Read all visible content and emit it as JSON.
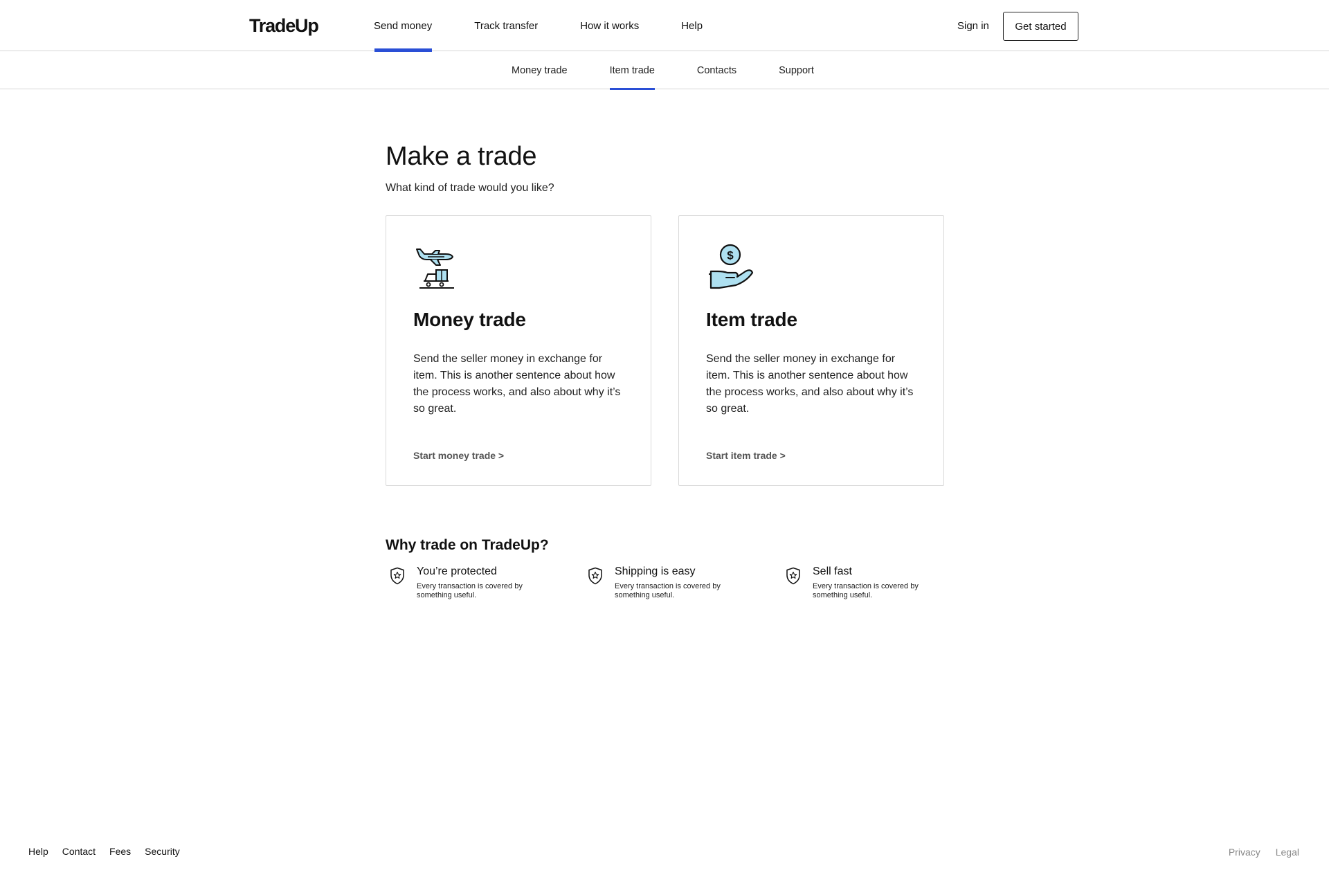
{
  "brand": {
    "name": "TradeUp",
    "accent_color": "#2a4fd6",
    "icon_fill": "#aee0f0"
  },
  "topnav": {
    "links": [
      {
        "label": "Send money",
        "active": true
      },
      {
        "label": "Track transfer",
        "active": false
      },
      {
        "label": "How it works",
        "active": false
      },
      {
        "label": "Help",
        "active": false
      }
    ],
    "sign_in": "Sign in",
    "get_started": "Get started"
  },
  "subnav": {
    "links": [
      {
        "label": "Money trade",
        "active": false
      },
      {
        "label": "Item trade",
        "active": true
      },
      {
        "label": "Contacts",
        "active": false
      },
      {
        "label": "Support",
        "active": false
      }
    ]
  },
  "main": {
    "title": "Make a trade",
    "subtitle": "What kind of trade would you like?",
    "cards": [
      {
        "icon": "airplane-delivery-icon",
        "title": "Money trade",
        "description": "Send the seller money in exchange for item. This is another sentence about how the process works, and also about why it’s so great.",
        "link": "Start money trade >"
      },
      {
        "icon": "hand-coin-icon",
        "title": "Item trade",
        "description": "Send the seller money in exchange for item. This is another sentence about how the process works, and also about why it’s so great.",
        "link": "Start item trade >"
      }
    ],
    "why": {
      "title": "Why trade on TradeUp?",
      "features": [
        {
          "icon": "shield-star-icon",
          "title": "You’re protected",
          "description": "Every transaction is covered by something useful."
        },
        {
          "icon": "shield-star-icon",
          "title": "Shipping is easy",
          "description": "Every transaction is covered by something useful."
        },
        {
          "icon": "shield-star-icon",
          "title": "Sell fast",
          "description": "Every transaction is covered by something useful."
        }
      ]
    }
  },
  "footer": {
    "left_links": [
      "Help",
      "Contact",
      "Fees",
      "Security"
    ],
    "right_links": [
      "Privacy",
      "Legal"
    ]
  }
}
